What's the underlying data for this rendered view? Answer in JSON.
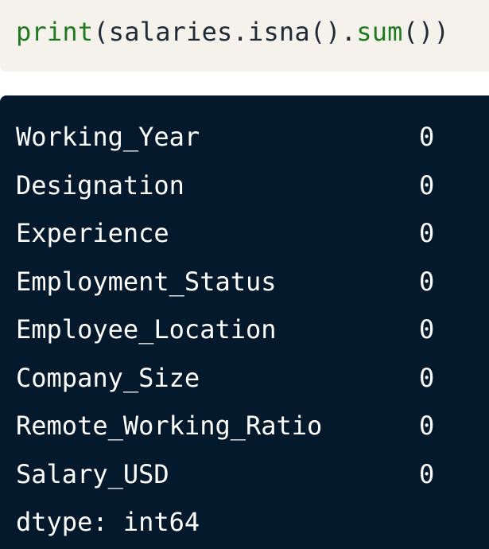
{
  "code_cell": {
    "tokens": [
      {
        "text": "print",
        "kind": "function"
      },
      {
        "text": "(salaries.isna().",
        "kind": "text"
      },
      {
        "text": "sum",
        "kind": "function"
      },
      {
        "text": "())",
        "kind": "text"
      }
    ]
  },
  "output_cell": {
    "rows": [
      {
        "name": "Working_Year",
        "value": "0"
      },
      {
        "name": "Designation",
        "value": "0"
      },
      {
        "name": "Experience",
        "value": "0"
      },
      {
        "name": "Employment_Status",
        "value": "0"
      },
      {
        "name": "Employee_Location",
        "value": "0"
      },
      {
        "name": "Company_Size",
        "value": "0"
      },
      {
        "name": "Remote_Working_Ratio",
        "value": "0"
      },
      {
        "name": "Salary_USD",
        "value": "0"
      }
    ],
    "dtype_line": "dtype: int64"
  },
  "colors": {
    "code_background": "#f5f2ec",
    "code_function": "#1f7a1f",
    "code_text": "#1f2a37",
    "output_background": "#05192d",
    "output_text": "#ffffff"
  }
}
